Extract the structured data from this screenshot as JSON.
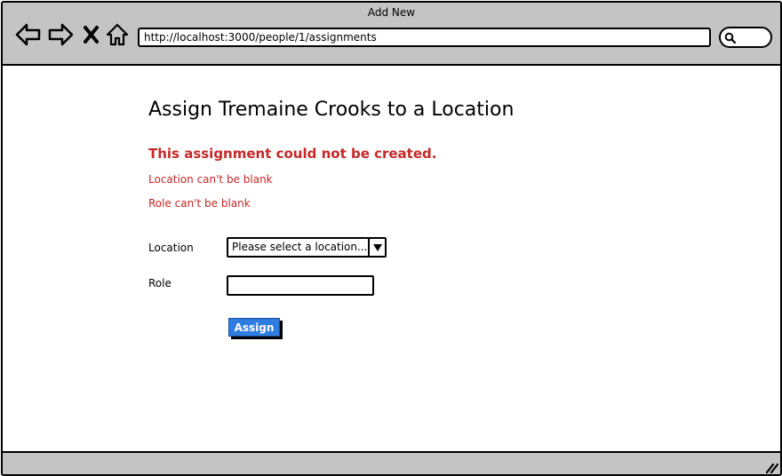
{
  "window": {
    "title": "Add New"
  },
  "toolbar": {
    "icons": [
      "back-arrow-icon",
      "forward-arrow-icon",
      "close-x-icon",
      "home-icon",
      "search-icon"
    ]
  },
  "address_bar": {
    "url": "http://localhost:3000/people/1/assignments"
  },
  "page": {
    "title": "Assign Tremaine Crooks to a Location"
  },
  "errors": {
    "heading": "This assignment could not be created.",
    "messages": [
      "Location can't be blank",
      "Role can't be blank"
    ]
  },
  "form": {
    "location_label": "Location",
    "location_selected": "Please select a location...",
    "role_label": "Role",
    "role_value": "",
    "submit_label": "Assign"
  },
  "colors": {
    "chrome": "#c4c4c4",
    "error": "#c62828",
    "button": "#2f7de1"
  }
}
